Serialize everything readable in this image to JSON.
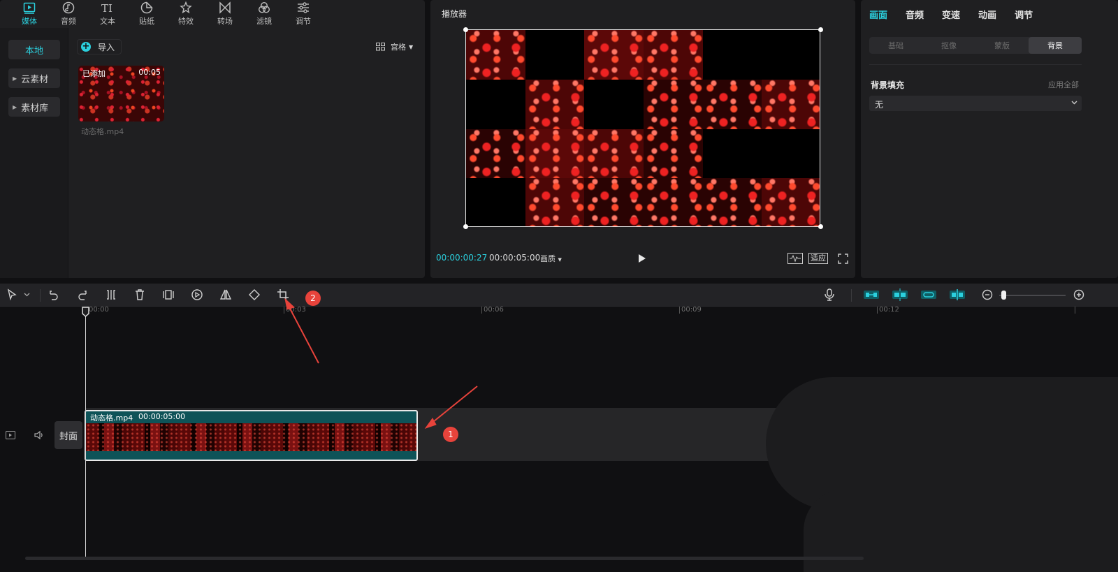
{
  "media_tabs": [
    {
      "label": "媒体",
      "icon": "media-icon",
      "active": true
    },
    {
      "label": "音频",
      "icon": "music-note-icon"
    },
    {
      "label": "文本",
      "icon": "text-icon"
    },
    {
      "label": "贴纸",
      "icon": "sticker-icon"
    },
    {
      "label": "特效",
      "icon": "sparkle-star-icon"
    },
    {
      "label": "转场",
      "icon": "transition-bowtie-icon"
    },
    {
      "label": "滤镜",
      "icon": "filter-circles-icon"
    },
    {
      "label": "调节",
      "icon": "adjust-sliders-icon"
    }
  ],
  "sidebar": {
    "local": "本地",
    "cloud": "云素材",
    "library": "素材库"
  },
  "toolbar": {
    "import_label": "导入",
    "grid_label": "宫格"
  },
  "asset": {
    "added_label": "已添加",
    "duration": "00:05",
    "filename": "动态格.mp4"
  },
  "player": {
    "title": "播放器",
    "current_time": "00:00:00:27",
    "total_time": "00:00:05:00",
    "quality_label": "画质",
    "fit_label": "适应"
  },
  "props": {
    "tabs": [
      "画面",
      "音频",
      "变速",
      "动画",
      "调节"
    ],
    "segments": [
      "基础",
      "抠像",
      "蒙版",
      "背景"
    ],
    "fill_title": "背景填充",
    "apply_all": "应用全部",
    "fill_value": "无"
  },
  "timeline": {
    "ruler": [
      "00:00",
      "00:03",
      "00:06",
      "00:09",
      "00:12"
    ],
    "clip_name": "动态格.mp4",
    "clip_duration": "00:00:05:00",
    "cover_label": "封面",
    "badges": [
      "1",
      "2"
    ]
  },
  "colors": {
    "accent": "#2bd0de",
    "annotation": "#e8433b",
    "clip_bg": "#0e5358"
  }
}
